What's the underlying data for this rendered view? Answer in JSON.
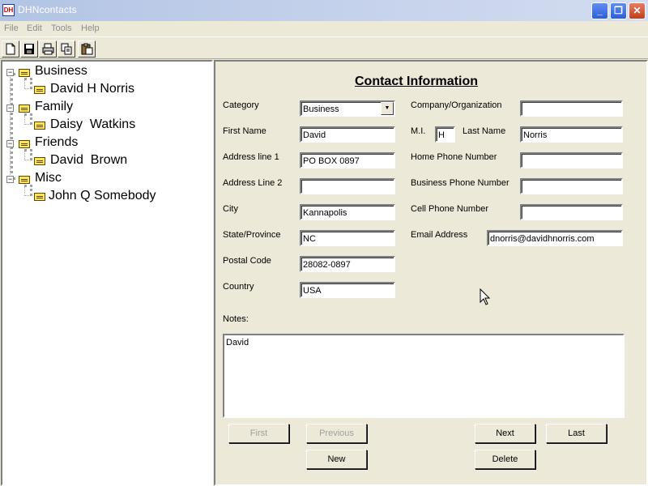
{
  "window": {
    "title": "DHNcontacts",
    "icon_text": "DH"
  },
  "menu": [
    "File",
    "Edit",
    "Tools",
    "Help"
  ],
  "toolbar": [
    "new-icon",
    "save-icon",
    "print-icon",
    "copy-icon",
    "paste-icon"
  ],
  "tree": {
    "groups": [
      {
        "label": "Business",
        "child": "David H Norris"
      },
      {
        "label": "Family",
        "child": "Daisy  Watkins"
      },
      {
        "label": "Friends",
        "child": "David  Brown"
      },
      {
        "label": "Misc",
        "child": "John Q Somebody"
      }
    ]
  },
  "form": {
    "title": "Contact Information",
    "labels": {
      "category": "Category",
      "first_name": "First Name",
      "address1": "Address line 1",
      "address2": "Address Line 2",
      "city": "City",
      "state": "State/Province",
      "postal": "Postal Code",
      "country": "Country",
      "company": "Company/Organization",
      "mi": "M.I.",
      "last_name": "Last Name",
      "home_phone": "Home Phone Number",
      "business_phone": "Business Phone Number",
      "cell_phone": "Cell Phone Number",
      "email": "Email Address",
      "notes": "Notes:"
    },
    "values": {
      "category": "Business",
      "first_name": "David",
      "address1": "PO BOX 0897",
      "address2": "",
      "city": "Kannapolis",
      "state": "NC",
      "postal": "28082-0897",
      "country": "USA",
      "company": "",
      "mi": "H",
      "last_name": "Norris",
      "home_phone": "",
      "business_phone": "",
      "cell_phone": "",
      "email": "dnorris@davidhnorris.com",
      "notes": "David"
    },
    "buttons": {
      "first": "First",
      "previous": "Previous",
      "next": "Next",
      "last": "Last",
      "new": "New",
      "delete": "Delete"
    }
  },
  "colors": {
    "titlebar": "#b2c4e4",
    "panel": "#ece9d8",
    "close": "#c13f1d"
  }
}
